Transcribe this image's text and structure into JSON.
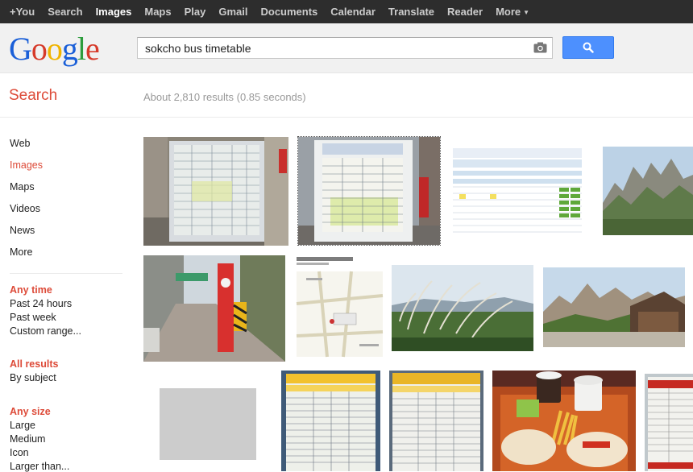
{
  "topbar": {
    "items": [
      "+You",
      "Search",
      "Images",
      "Maps",
      "Play",
      "Gmail",
      "Documents",
      "Calendar",
      "Translate",
      "Reader",
      "More"
    ],
    "active": "Images"
  },
  "logo": {
    "text": [
      "G",
      "o",
      "o",
      "g",
      "l",
      "e"
    ]
  },
  "search": {
    "query": "sokcho bus timetable",
    "camera_icon": "camera-icon",
    "button_icon": "search-icon"
  },
  "subheader": {
    "section_title": "Search",
    "result_stats": "About 2,810 results (0.85 seconds)"
  },
  "leftnav": {
    "items": [
      "Web",
      "Images",
      "Maps",
      "Videos",
      "News",
      "More"
    ],
    "active": "Images",
    "time": {
      "heading": "Any time",
      "options": [
        "Past 24 hours",
        "Past week",
        "Custom range..."
      ]
    },
    "results": {
      "heading": "All results",
      "options": [
        "By subject"
      ]
    },
    "size": {
      "heading": "Any size",
      "options": [
        "Large",
        "Medium",
        "Icon",
        "Larger than..."
      ]
    }
  },
  "colors": {
    "accent_red": "#dd4b39",
    "search_blue": "#4d90fe",
    "topbar_bg": "#2d2d2d"
  },
  "results": [
    {
      "kind": "bus-timetable-photo"
    },
    {
      "kind": "bus-timetable-photo-selected"
    },
    {
      "kind": "timetable-web-page"
    },
    {
      "kind": "mountain-peaks"
    },
    {
      "kind": "street-bus-stop"
    },
    {
      "kind": "terminal-map"
    },
    {
      "kind": "pampas-grass"
    },
    {
      "kind": "temple-mountains"
    },
    {
      "kind": "placeholder-gray"
    },
    {
      "kind": "timetable-board-yellow"
    },
    {
      "kind": "timetable-board-yellow"
    },
    {
      "kind": "burger-meal"
    },
    {
      "kind": "timetable-board-red"
    }
  ]
}
